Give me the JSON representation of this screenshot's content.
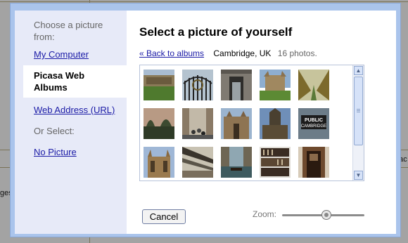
{
  "sidebar": {
    "intro": "Choose a picture from:",
    "my_computer": "My Computer",
    "picasa": "Picasa Web Albums",
    "web_address": "Web Address (URL)",
    "or_select": "Or Select:",
    "no_picture": "No Picture"
  },
  "main": {
    "title": "Select a picture of yourself",
    "back_link": "« Back to albums",
    "album_name": "Cambridge, UK",
    "photo_count": "16 photos."
  },
  "photos": [
    {
      "name": "college-lawn"
    },
    {
      "name": "iron-gate"
    },
    {
      "name": "stone-archway"
    },
    {
      "name": "chapel-lawn"
    },
    {
      "name": "tree-avenue"
    },
    {
      "name": "dusk-trees"
    },
    {
      "name": "street-crowd"
    },
    {
      "name": "gothic-facade"
    },
    {
      "name": "chapel-tower"
    },
    {
      "name": "public-cambridge-sign",
      "text": "PUBLIC CAMBRIDGE"
    },
    {
      "name": "kings-chapel"
    },
    {
      "name": "glass-roof-market"
    },
    {
      "name": "river-punts"
    },
    {
      "name": "bookshelves"
    },
    {
      "name": "doorway"
    }
  ],
  "footer": {
    "cancel_label": "Cancel",
    "zoom_label": "Zoom:",
    "zoom_level": 0.54
  },
  "background": {
    "left_fragment": "ges",
    "right_fragment": "ntac"
  }
}
